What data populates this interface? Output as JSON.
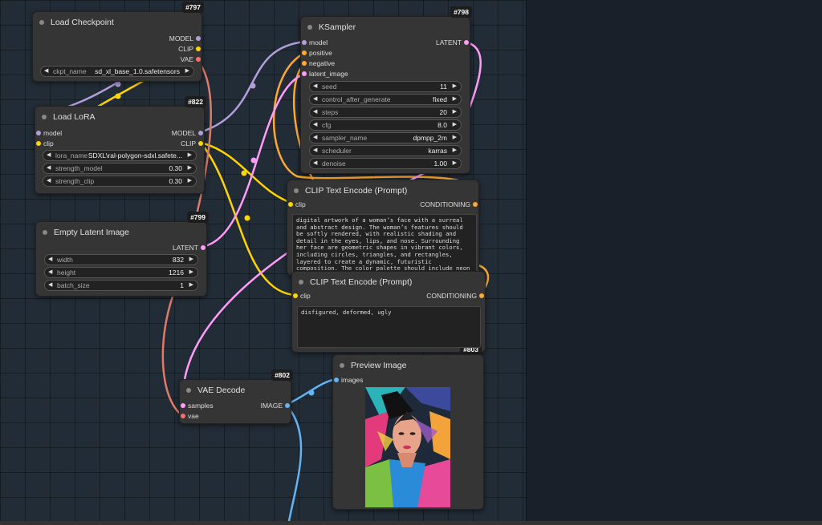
{
  "colors": {
    "model": "#b39ddb",
    "clip": "#ffd500",
    "vae": "#ff6e6e",
    "latent": "#ff9cf9",
    "conditioning": "#ffa931",
    "image": "#64b5f6"
  },
  "nodes": {
    "load_checkpoint": {
      "id": "#797",
      "title": "Load Checkpoint",
      "outputs": [
        "MODEL",
        "CLIP",
        "VAE"
      ],
      "widget": {
        "label": "ckpt_name",
        "value": "sd_xl_base_1.0.safetensors"
      }
    },
    "load_lora": {
      "id": "#822",
      "title": "Load LoRA",
      "inputs": [
        "model",
        "clip"
      ],
      "outputs": [
        "MODEL",
        "CLIP"
      ],
      "widgets": [
        {
          "label": "lora_name",
          "value": "SDXL\\ral-polygon-sdxl.safete..."
        },
        {
          "label": "strength_model",
          "value": "0.30"
        },
        {
          "label": "strength_clip",
          "value": "0.30"
        }
      ]
    },
    "empty_latent": {
      "id": "#799",
      "title": "Empty Latent Image",
      "outputs": [
        "LATENT"
      ],
      "widgets": [
        {
          "label": "width",
          "value": "832"
        },
        {
          "label": "height",
          "value": "1216"
        },
        {
          "label": "batch_size",
          "value": "1"
        }
      ]
    },
    "ksampler": {
      "id": "#798",
      "title": "KSampler",
      "inputs": [
        "model",
        "positive",
        "negative",
        "latent_image"
      ],
      "outputs": [
        "LATENT"
      ],
      "widgets": [
        {
          "label": "seed",
          "value": "11"
        },
        {
          "label": "control_after_generate",
          "value": "fixed"
        },
        {
          "label": "steps",
          "value": "20"
        },
        {
          "label": "cfg",
          "value": "8.0"
        },
        {
          "label": "sampler_name",
          "value": "dpmpp_2m"
        },
        {
          "label": "scheduler",
          "value": "karras"
        },
        {
          "label": "denoise",
          "value": "1.00"
        }
      ]
    },
    "clip_pos": {
      "title": "CLIP Text Encode (Prompt)",
      "inputs": [
        "clip"
      ],
      "outputs": [
        "CONDITIONING"
      ],
      "text": "digital artwork of a woman’s face with a surreal and abstract design. The woman’s features should be softly rendered, with realistic shading and detail in the eyes, lips, and nose. Surrounding her face are geometric shapes in vibrant colors, including circles, triangles, and rectangles, layered to create a dynamic, futuristic composition. The color palette should include neon pinks, greens, blues,"
    },
    "clip_neg": {
      "id": "#803",
      "title": "CLIP Text Encode (Prompt)",
      "inputs": [
        "clip"
      ],
      "outputs": [
        "CONDITIONING"
      ],
      "text": "disfigured, deformed, ugly"
    },
    "vae_decode": {
      "id": "#802",
      "title": "VAE Decode",
      "inputs": [
        "samples",
        "vae"
      ],
      "outputs": [
        "IMAGE"
      ]
    },
    "preview": {
      "title": "Preview Image",
      "inputs": [
        "images"
      ]
    }
  }
}
